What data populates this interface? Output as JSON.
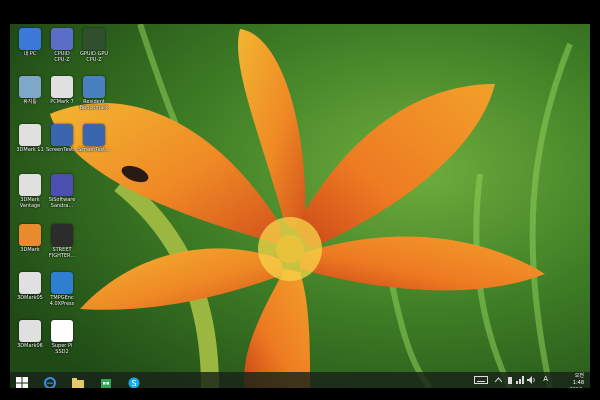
{
  "desktop": {
    "icons": [
      {
        "label": "내 PC",
        "icon": "this-pc-icon",
        "color": "#3b78d8"
      },
      {
        "label": "CPUID\nCPU-Z",
        "icon": "cpuz-icon",
        "color": "#5a6ec8"
      },
      {
        "label": "GPUID GPU\nCPU-Z",
        "icon": "gpuz-icon",
        "color": "#2f4f2f"
      },
      {
        "label": "휴지통",
        "icon": "recycle-bin-icon",
        "color": "#7fa7c8"
      },
      {
        "label": "PCMark 7",
        "icon": "pcmark-icon",
        "color": "#e0e0e0"
      },
      {
        "label": "Resident\nBenchmark",
        "icon": "resident-benchmark-icon",
        "color": "#4a7fc0"
      },
      {
        "label": "3DMark 11",
        "icon": "3dmark-icon",
        "color": "#e0e0e0"
      },
      {
        "label": "ScreenTest...",
        "icon": "screentest-icon",
        "color": "#3a66b0"
      },
      {
        "label": "ScreenTest...",
        "icon": "screentest-icon",
        "color": "#3a66b0"
      },
      {
        "label": "3DMark\nVantage",
        "icon": "3dmark-vantage-icon",
        "color": "#e0e0e0"
      },
      {
        "label": "SiSoftware\nSandra...",
        "icon": "sisoftware-icon",
        "color": "#4d4fb0"
      },
      {
        "label": "3DMark",
        "icon": "3dmark-icon",
        "color": "#e88a2e"
      },
      {
        "label": "STREET\nFIGHTER...",
        "icon": "street-fighter-icon",
        "color": "#2c2c2c"
      },
      {
        "label": "3DMark05",
        "icon": "3dmark05-icon",
        "color": "#e0e0e0"
      },
      {
        "label": "TMPGEnc\n4.0XPress",
        "icon": "tmpgenc-icon",
        "color": "#2f7fd0"
      },
      {
        "label": "3DMark06",
        "icon": "3dmark06-icon",
        "color": "#e0e0e0"
      },
      {
        "label": "Super Pi\nSSD2",
        "icon": "super-pi-icon",
        "color": "#ffffff"
      }
    ]
  },
  "taskbar": {
    "buttons": [
      {
        "icon": "windows-start-icon",
        "color": "#ffffff"
      },
      {
        "icon": "internet-explorer-icon",
        "color": "#3c8de0"
      },
      {
        "icon": "file-explorer-icon",
        "color": "#e8c86a"
      },
      {
        "icon": "windows-store-icon",
        "color": "#2fa84f"
      },
      {
        "icon": "skype-icon",
        "color": "#19a7e8"
      }
    ],
    "tray_icons": [
      "keyboard-icon",
      "chevron-up-icon",
      "battery-icon",
      "network-icon",
      "volume-icon"
    ],
    "ime": "A",
    "time": "오전 1:48",
    "date": "2012-07-02"
  }
}
